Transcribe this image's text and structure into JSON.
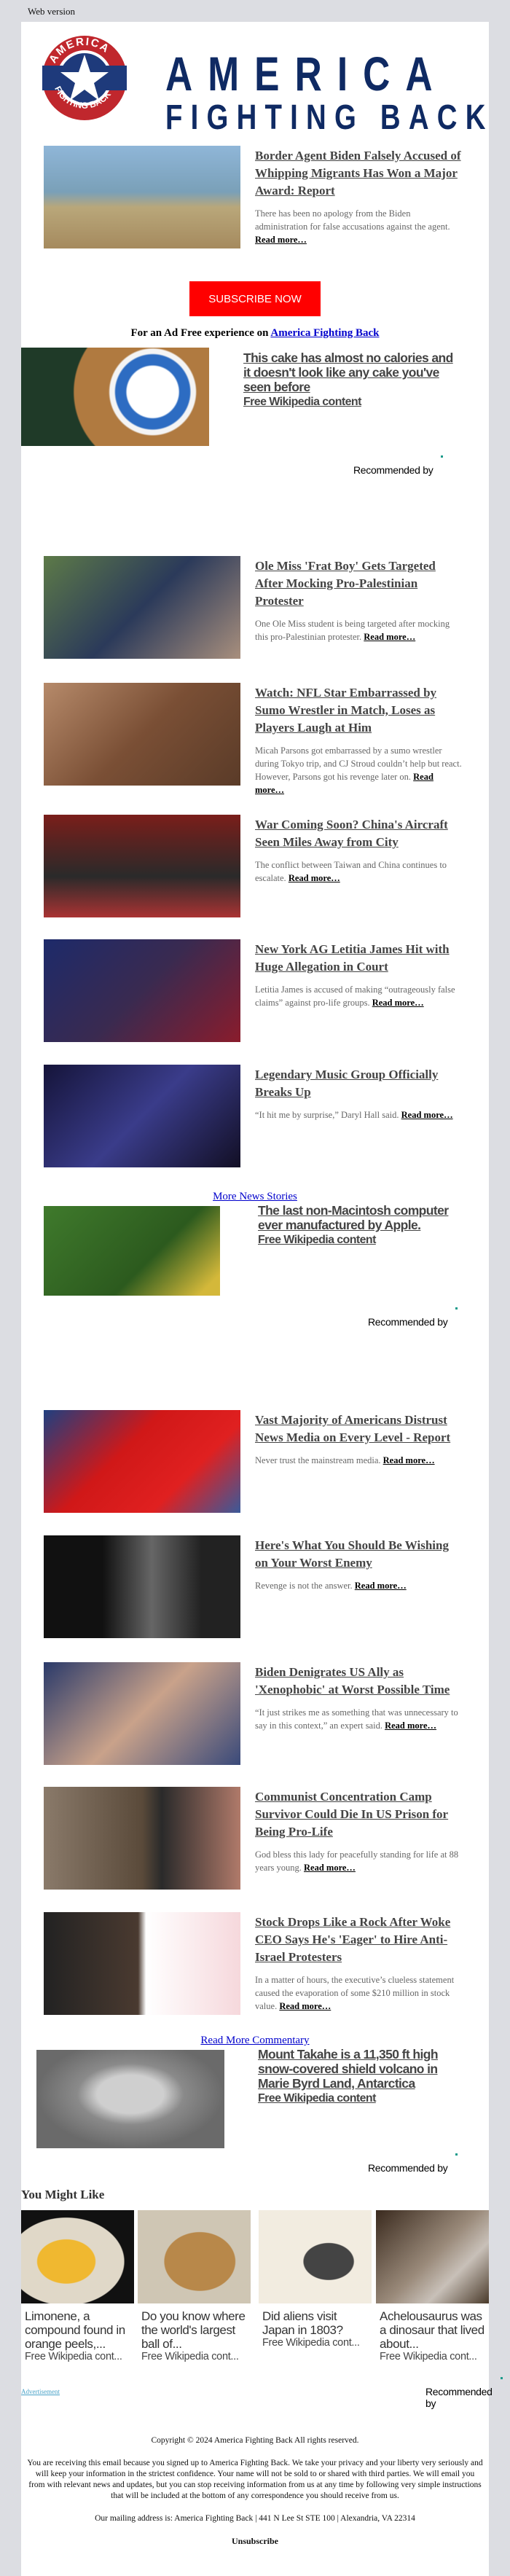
{
  "header": {
    "web_version": "Web version",
    "logo_top": "AMERICA",
    "logo_bottom": "FIGHTING BACK",
    "seal_top": "AMERICA",
    "seal_bottom": "FIGHTING BACK"
  },
  "subscribe": {
    "label": "SUBSCRIBE NOW"
  },
  "ad_free": {
    "text": "For an Ad Free experience on ",
    "link": "America Fighting Back"
  },
  "read_more_label": "Read more…",
  "stories": [
    {
      "title": "Border Agent Biden Falsely Accused of Whipping Migrants Has Won a Major Award: Report",
      "summary": "There has been no apology from the Biden administration for false accusations against the agent."
    },
    {
      "title": "Ole Miss 'Frat Boy' Gets Targeted After Mocking Pro-Palestinian Protester",
      "summary": "One Ole Miss student is being targeted after mocking this pro-Palestinian protester."
    },
    {
      "title": "Watch: NFL Star Embarrassed by Sumo Wrestler in Match, Loses as Players Laugh at Him",
      "summary": "Micah Parsons got embarrassed by a sumo wrestler during Tokyo trip, and CJ Stroud couldn’t help but react. However, Parsons got his revenge later on."
    },
    {
      "title": "War Coming Soon? China's Aircraft Seen Miles Away from City",
      "summary": "The conflict between Taiwan and China continues to escalate."
    },
    {
      "title": "New York AG Letitia James Hit with Huge Allegation in Court",
      "summary": "Letitia James is accused of making “outrageously false claims” against pro-life groups."
    },
    {
      "title": "Legendary Music Group Officially Breaks Up",
      "summary": "“It hit me by surprise,” Daryl Hall said."
    },
    {
      "title": "Vast Majority of Americans Distrust News Media on Every Level - Report",
      "summary": "Never trust the mainstream media."
    },
    {
      "title": "Here's What You Should Be Wishing on Your Worst Enemy",
      "summary": "Revenge is not the answer."
    },
    {
      "title": "Biden Denigrates US Ally as 'Xenophobic' at Worst Possible Time",
      "summary": "“It just strikes me as something that was unnecessary to say in this context,” an expert said."
    },
    {
      "title": "Communist Concentration Camp Survivor Could Die In US Prison for Being Pro-Life",
      "summary": "God bless this lady for peacefully standing for life at 88 years young."
    },
    {
      "title": "Stock Drops Like a Rock After Woke CEO Says He's 'Eager' to Hire Anti-Israel Protesters",
      "summary": "In a matter of hours, the executive’s clueless statement caused the evaporation of some $210 million in stock value."
    }
  ],
  "ads": [
    {
      "title": "This cake has almost no calories and it doesn't look like any cake you've seen before",
      "source": "Free Wikipedia content"
    },
    {
      "title": "The last non-Macintosh computer ever manufactured by Apple.",
      "source": "Free Wikipedia content"
    },
    {
      "title": "Mount Takahe is a 11,350 ft high snow-covered shield volcano in Marie Byrd Land, Antarctica",
      "source": "Free Wikipedia content"
    }
  ],
  "recommended_by": "Recommended by",
  "more_news": "More News Stories",
  "more_commentary": "Read More Commentary",
  "you_might_like": {
    "heading": "You Might Like",
    "cards": [
      {
        "title": "Limonene, a compound found in orange peels,...",
        "source": "Free Wikipedia cont..."
      },
      {
        "title": "Do you know where the world's largest ball of...",
        "source": "Free Wikipedia cont..."
      },
      {
        "title": "Did aliens visit Japan in 1803?",
        "source": "Free Wikipedia cont..."
      },
      {
        "title": "Achelousaurus was a dinosaur that lived about...",
        "source": "Free Wikipedia cont..."
      }
    ]
  },
  "advertisement": "Advertisement",
  "footer": {
    "copyright": "Copyright © 2024 America Fighting Back All rights reserved.",
    "notice": "You are receiving this email because you signed up to America Fighting Back. We take your privacy and your liberty very seriously and will keep your information in the strictest confidence. Your name will not be sold to or shared with third parties. We will email you from with relevant news and updates, but you can stop receiving information from us at any time by following very simple instructions that will be included at the bottom of any correspondence you should receive from us.",
    "address": "Our mailing address is: America Fighting Back | 441 N Lee St STE 100 | Alexandria, VA 22314",
    "unsubscribe": "Unsubscribe"
  },
  "colors": {
    "brand_navy": "#0f2a63",
    "brand_red": "#c0272d",
    "subscribe_bg": "#ff0000",
    "link_blue": "#0000cc",
    "page_bg": "#dcdde2"
  }
}
